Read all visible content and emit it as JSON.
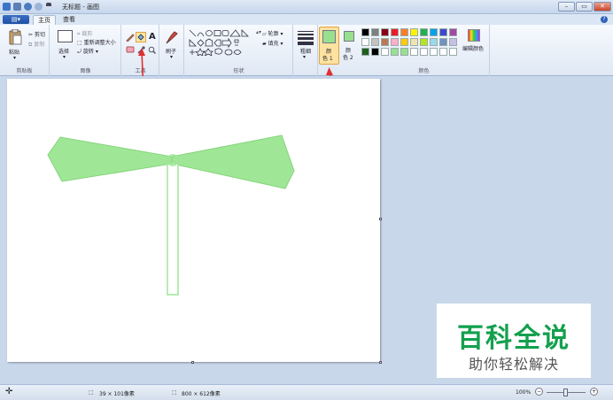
{
  "window": {
    "title": "无标题 - 画图",
    "controls": [
      "–",
      "▭",
      "✕"
    ]
  },
  "tabs": {
    "file_icon": "▤▾",
    "home": "主页",
    "view": "查看",
    "help": "?"
  },
  "ribbon": {
    "clipboard": {
      "paste": "粘贴",
      "cut": "剪切",
      "copy": "复制",
      "title": "剪贴板"
    },
    "image": {
      "select": "选择",
      "crop": "裁剪",
      "resize": "重新调整大小",
      "rotate": "旋转",
      "title": "图像"
    },
    "tools": {
      "title": "工具",
      "text_tool": "A"
    },
    "brushes": {
      "label": "刷子"
    },
    "shapes": {
      "outline": "轮廓",
      "fill": "填充",
      "title": "形状"
    },
    "size": {
      "label": "粗细"
    },
    "color1": {
      "label_line1": "颜",
      "label_line2": "色 1",
      "value": "#98e08f"
    },
    "color2": {
      "label_line1": "颜",
      "label_line2": "色 2",
      "value": "#98e08f"
    },
    "colors": {
      "title": "颜色",
      "edit": "编辑颜色",
      "row1": [
        "#000000",
        "#7f7f7f",
        "#880015",
        "#ed1c24",
        "#ff7f27",
        "#fff200",
        "#22b14c",
        "#00a2e8",
        "#3f48cc",
        "#a349a4"
      ],
      "row2": [
        "#ffffff",
        "#c3c3c3",
        "#b97a57",
        "#ffaec9",
        "#ffc90e",
        "#efe4b0",
        "#b5e61d",
        "#99d9ea",
        "#7092be",
        "#c8bfe7"
      ],
      "row3": [
        "#1f5e1f",
        "#000000",
        "#ffffff",
        "#99e092",
        "#98e08f",
        "#ffffff",
        "#ffffff",
        "#ffffff",
        "#ffffff",
        "#ffffff"
      ]
    }
  },
  "drawing": {
    "fill_color": "#9fe796",
    "stroke_color": "#86d47c"
  },
  "watermark": {
    "title": "百科全说",
    "subtitle": "助你轻松解决"
  },
  "status": {
    "position": "39 × 101像素",
    "canvas_size": "800 × 612像素",
    "zoom": "100%"
  },
  "colors": {
    "accent_red": "#e03030",
    "ribbon_blue": "#1d4fa3"
  }
}
